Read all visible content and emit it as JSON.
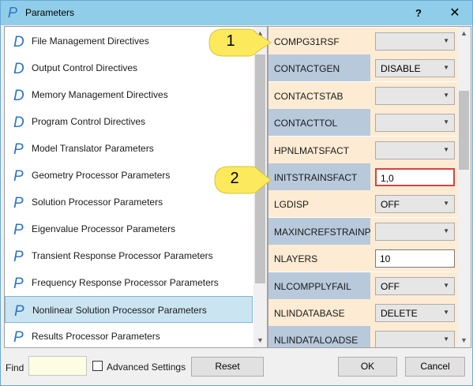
{
  "window": {
    "title": "Parameters",
    "help_label": "?",
    "close_label": "✕",
    "icon_letter": "P"
  },
  "sections": [
    {
      "icon": "D",
      "label": "File Management Directives"
    },
    {
      "icon": "D",
      "label": "Output Control Directives"
    },
    {
      "icon": "D",
      "label": "Memory Management Directives"
    },
    {
      "icon": "D",
      "label": "Program Control Directives"
    },
    {
      "icon": "P",
      "label": "Model Translator Parameters"
    },
    {
      "icon": "P",
      "label": "Geometry Processor Parameters"
    },
    {
      "icon": "P",
      "label": "Solution Processor Parameters"
    },
    {
      "icon": "P",
      "label": "Eigenvalue Processor Parameters"
    },
    {
      "icon": "P",
      "label": "Transient Response Processor Parameters"
    },
    {
      "icon": "P",
      "label": "Frequency Response Processor Parameters"
    },
    {
      "icon": "P",
      "label": "Nonlinear Solution Processor Parameters"
    },
    {
      "icon": "P",
      "label": "Results Processor Parameters"
    },
    {
      "icon": "P",
      "label": ""
    }
  ],
  "selected_section_index": 10,
  "properties": [
    {
      "name": "COMPG31RSF",
      "kind": "combo",
      "value": ""
    },
    {
      "name": "CONTACTGEN",
      "kind": "combo",
      "value": "DISABLE"
    },
    {
      "name": "CONTACTSTAB",
      "kind": "combo",
      "value": ""
    },
    {
      "name": "CONTACTTOL",
      "kind": "combo",
      "value": ""
    },
    {
      "name": "HPNLMATSFACT",
      "kind": "combo",
      "value": ""
    },
    {
      "name": "INITSTRAINSFACT",
      "kind": "text",
      "value": "1,0",
      "focused": true
    },
    {
      "name": "LGDISP",
      "kind": "combo",
      "value": "OFF"
    },
    {
      "name": "MAXINCREFSTRAINP",
      "kind": "combo",
      "value": ""
    },
    {
      "name": "NLAYERS",
      "kind": "text",
      "value": "10"
    },
    {
      "name": "NLCOMPPLYFAIL",
      "kind": "combo",
      "value": "OFF"
    },
    {
      "name": "NLINDATABASE",
      "kind": "combo",
      "value": "DELETE"
    },
    {
      "name": "NLINDATALOADSE",
      "kind": "combo",
      "value": ""
    }
  ],
  "callouts": [
    {
      "number": "1"
    },
    {
      "number": "2"
    }
  ],
  "bottom": {
    "find_label": "Find",
    "find_value": "",
    "advanced_label": "Advanced Settings",
    "reset_label": "Reset",
    "ok_label": "OK",
    "cancel_label": "Cancel"
  },
  "colors": {
    "titlebar": "#90cde8",
    "icon_blue": "#2e75c8",
    "prop_light": "#fdebd3",
    "prop_dark": "#b8c9dc",
    "callout_fill": "#fdea5c",
    "selected": "#cbe4f2",
    "focus_border": "#d44545"
  }
}
